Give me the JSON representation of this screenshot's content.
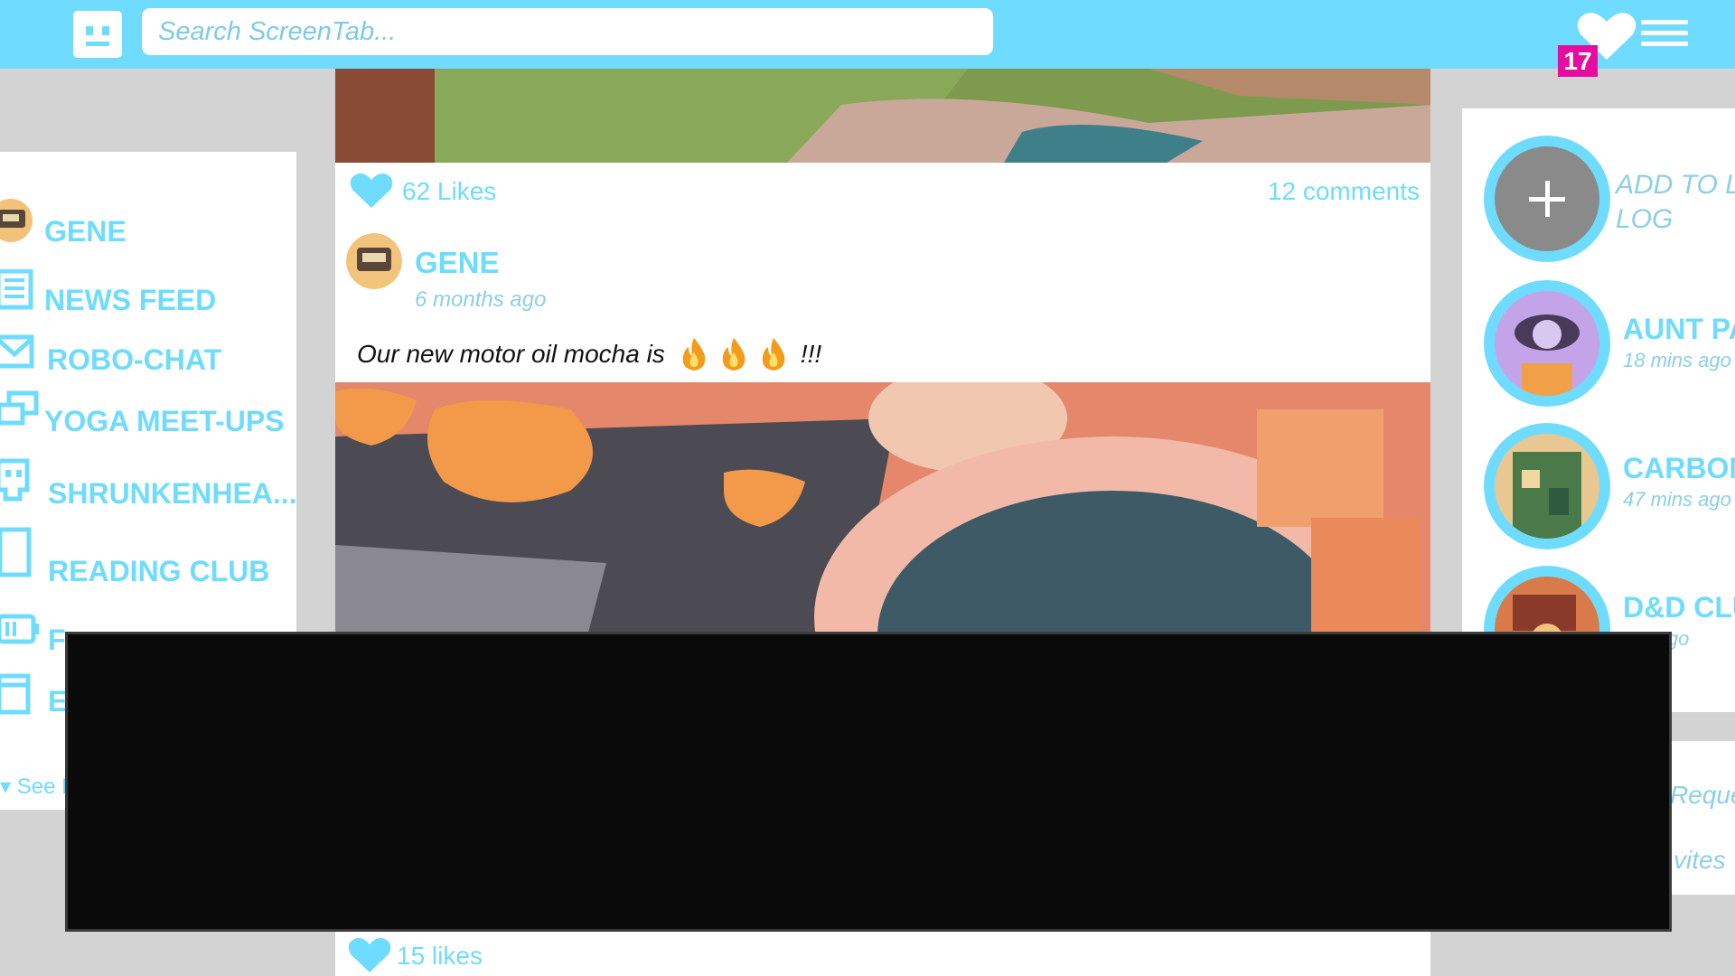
{
  "app": {
    "name": "ScreenTab"
  },
  "header": {
    "search_placeholder": "Search ScreenTab...",
    "notification_count": "17",
    "icons": [
      "robot-face-logo-icon",
      "heart-icon",
      "menu-icon"
    ]
  },
  "sidebar": {
    "items": [
      {
        "label": "GENE",
        "icon": "avatar"
      },
      {
        "label": "NEWS FEED",
        "icon": "newspaper-icon"
      },
      {
        "label": "ROBO-CHAT",
        "icon": "envelope-icon"
      },
      {
        "label": "YOGA MEET-UPS",
        "icon": "chat-bubbles-icon"
      },
      {
        "label": "SHRUNKENHEA...",
        "icon": "skull-icon"
      },
      {
        "label": "READING CLUB",
        "icon": "book-icon"
      },
      {
        "label": "F",
        "icon": "battery-icon"
      },
      {
        "label": "E",
        "icon": "calendar-icon"
      }
    ],
    "see_more": "See M"
  },
  "feed": {
    "prev_post": {
      "likes": "62 Likes",
      "comments": "12 comments"
    },
    "post": {
      "author": "GENE",
      "time": "6 months ago",
      "text": "Our new motor oil mocha is",
      "emphasis": "!!!",
      "emoji_count": 3,
      "likes": "15 likes"
    }
  },
  "stories": {
    "add_label": "ADD TO L LOG",
    "items": [
      {
        "name": "AUNT PA",
        "time": "18 mins ago"
      },
      {
        "name": "CARBON",
        "time": "47 mins ago"
      },
      {
        "name": "D&D CLU",
        "time": "urs ago"
      }
    ]
  },
  "right_links": {
    "requests": "Reque",
    "invites": "vites"
  },
  "colors": {
    "accent": "#6fdcff",
    "notification": "#e60ca0",
    "background": "#d3d3d3"
  }
}
